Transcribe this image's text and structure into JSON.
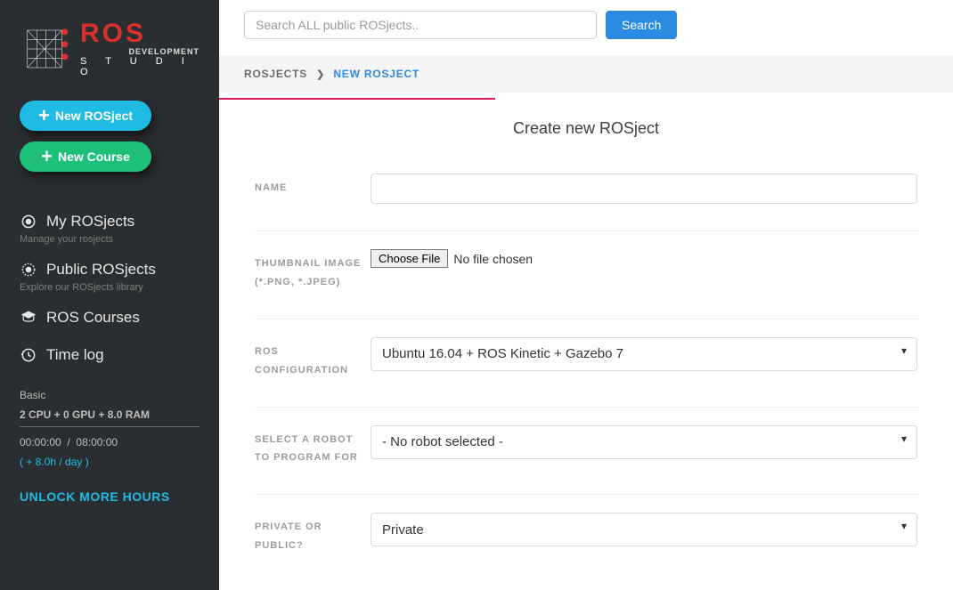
{
  "sidebar": {
    "logo": {
      "brand": "ROS",
      "sub1": "DEVELOPMENT",
      "sub2": "S  T  U  D  I  O"
    },
    "buttons": {
      "new_rosject": "New ROSject",
      "new_course": "New Course"
    },
    "nav": [
      {
        "label": "My ROSjects",
        "sub": "Manage your rosjects"
      },
      {
        "label": "Public ROSjects",
        "sub": "Explore our ROSjects library"
      },
      {
        "label": "ROS Courses",
        "sub": ""
      },
      {
        "label": "Time log",
        "sub": ""
      }
    ],
    "plan": {
      "tier": "Basic",
      "specs": "2 CPU  +  0 GPU  +  8.0 RAM",
      "time_used": "00:00:00",
      "time_total": "08:00:00",
      "add_hours": "( + 8.0h / day )"
    },
    "unlock": "UNLOCK MORE HOURS"
  },
  "search": {
    "placeholder": "Search ALL public ROSjects..",
    "button": "Search"
  },
  "breadcrumb": {
    "root": "ROSJECTS",
    "current": "NEW ROSJECT"
  },
  "page": {
    "title": "Create new ROSject"
  },
  "form": {
    "name": {
      "label": "Name",
      "value": ""
    },
    "thumbnail": {
      "label": "Thumbnail Image (*.PNG, *.JPEG)",
      "button": "Choose File",
      "status": "No file chosen"
    },
    "ros_config": {
      "label": "ROS Configuration",
      "value": "Ubuntu 16.04 + ROS Kinetic + Gazebo 7"
    },
    "robot": {
      "label": "Select a robot to program for",
      "value": "- No robot selected -"
    },
    "privacy": {
      "label": "Private or Public?",
      "value": "Private"
    }
  }
}
